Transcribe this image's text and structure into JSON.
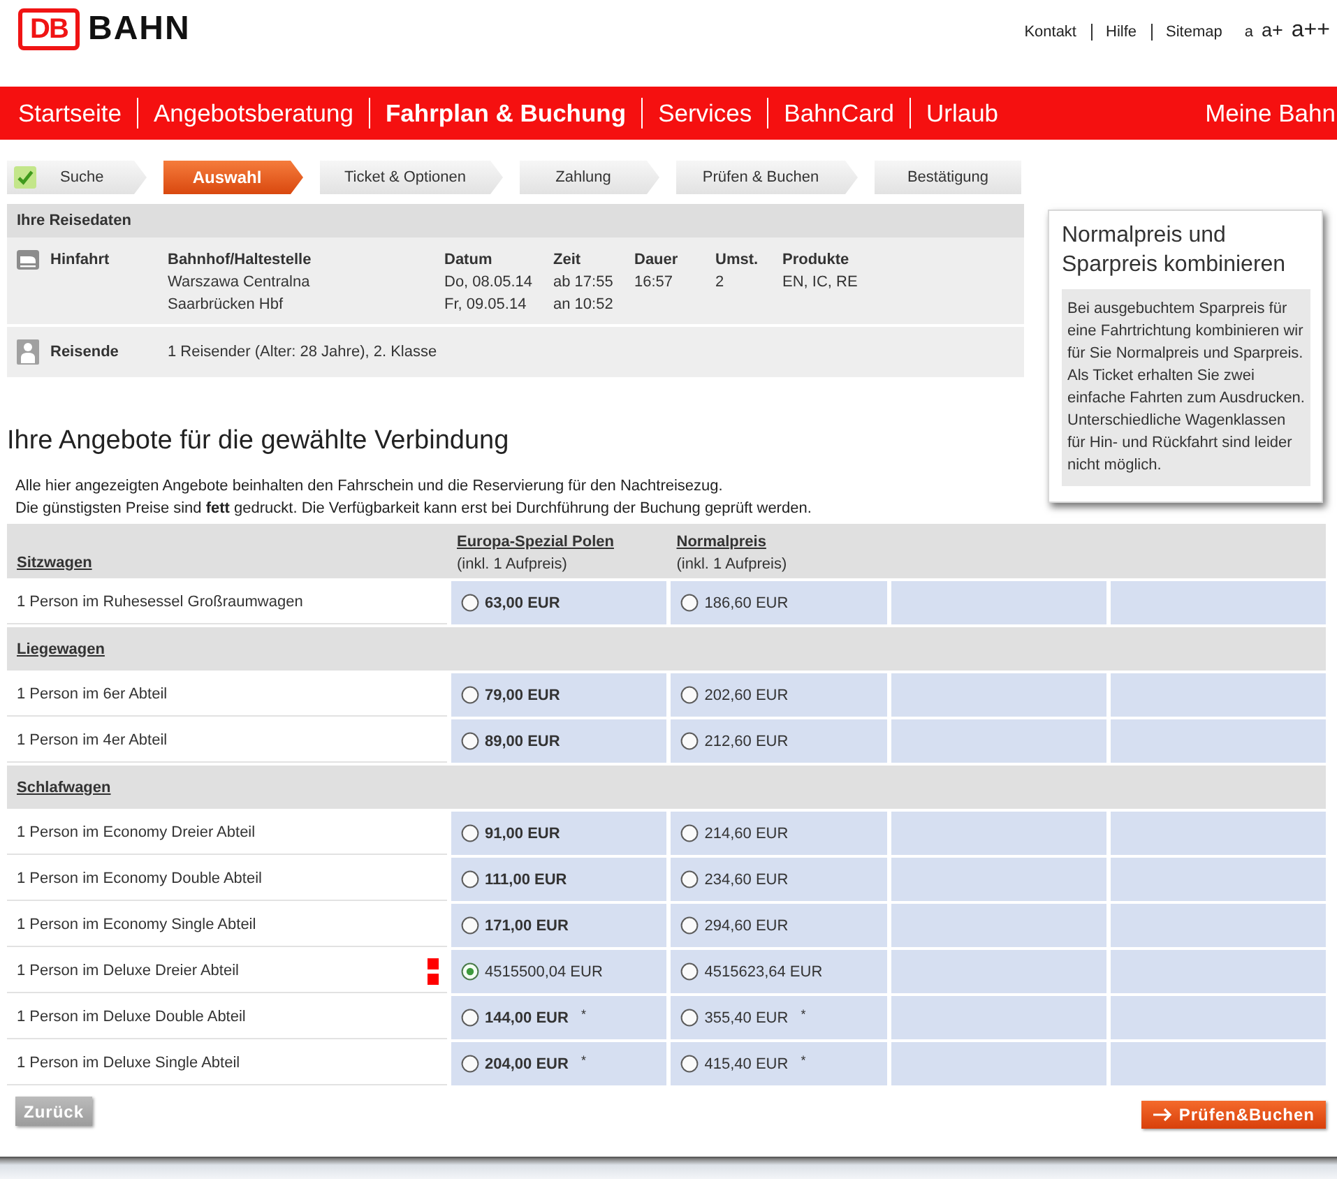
{
  "header": {
    "logo_mark": "DB",
    "logo_text": "BAHN",
    "links": [
      "Kontakt",
      "Hilfe",
      "Sitemap"
    ],
    "text_sizes": [
      "a",
      "a+",
      "a++"
    ]
  },
  "nav": {
    "items": [
      {
        "label": "Startseite",
        "selected": false
      },
      {
        "label": "Angebotsberatung",
        "selected": false
      },
      {
        "label": "Fahrplan & Buchung",
        "selected": true
      },
      {
        "label": "Services",
        "selected": false
      },
      {
        "label": "BahnCard",
        "selected": false
      },
      {
        "label": "Urlaub",
        "selected": false
      }
    ],
    "account": "Meine Bahn"
  },
  "steps": [
    {
      "label": "Suche",
      "selected": false,
      "done": true
    },
    {
      "label": "Auswahl",
      "selected": true,
      "done": false
    },
    {
      "label": "Ticket & Optionen",
      "selected": false,
      "done": false
    },
    {
      "label": "Zahlung",
      "selected": false,
      "done": false
    },
    {
      "label": "Prüfen & Buchen",
      "selected": false,
      "done": false
    },
    {
      "label": "Bestätigung",
      "selected": false,
      "done": false
    }
  ],
  "travel": {
    "title": "Ihre Reisedaten",
    "journey": {
      "label": "Hinfahrt",
      "columns": [
        {
          "heading": "Bahnhof/Haltestelle",
          "lines": [
            "Warszawa Centralna",
            "Saarbrücken Hbf"
          ]
        },
        {
          "heading": "Datum",
          "lines": [
            "Do, 08.05.14",
            "Fr, 09.05.14"
          ]
        },
        {
          "heading": "Zeit",
          "lines": [
            "ab 17:55",
            "an 10:52"
          ]
        },
        {
          "heading": "Dauer",
          "lines": [
            "16:57"
          ]
        },
        {
          "heading": "Umst.",
          "lines": [
            "2"
          ]
        },
        {
          "heading": "Produkte",
          "lines": [
            "EN, IC, RE"
          ]
        }
      ]
    },
    "travellers": {
      "label": "Reisende",
      "text": "1 Reisender (Alter: 28 Jahre), 2. Klasse"
    }
  },
  "info_box": {
    "title": "Normalpreis und Sparpreis kombinieren",
    "text": "Bei ausgebuchtem Sparpreis für eine Fahrtrichtung kombinieren wir für Sie Normalpreis und Sparpreis. Als Ticket erhalten Sie zwei einfache Fahrten zum Ausdrucken. Unterschiedliche Wagenklassen für Hin- und Rückfahrt sind leider nicht möglich."
  },
  "offers": {
    "title": "Ihre Angebote für die gewählte Verbindung",
    "notes": [
      "Alle hier angezeigten Angebote beinhalten den Fahrschein und die Reservierung für den Nachtreisezug.",
      "Die günstigsten Preise sind **fett** gedruckt. Die Verfügbarkeit kann erst bei Durchführung der Buchung geprüft werden."
    ],
    "columns": [
      {
        "name": "Europa-Spezial Polen",
        "note": "(inkl. 1 Aufpreis)"
      },
      {
        "name": "Normalpreis",
        "note": "(inkl. 1 Aufpreis)"
      }
    ],
    "groups": [
      {
        "title": "Sitzwagen",
        "rows": [
          {
            "label": "1 Person im Ruhesessel Großraumwagen",
            "flagged": false,
            "offers": [
              {
                "price": "63,00 EUR",
                "cheapest": true,
                "selected": false
              },
              {
                "price": "186,60 EUR",
                "cheapest": false,
                "selected": false
              }
            ]
          }
        ]
      },
      {
        "title": "Liegewagen",
        "rows": [
          {
            "label": "1 Person im 6er Abteil",
            "flagged": false,
            "offers": [
              {
                "price": "79,00 EUR",
                "cheapest": true,
                "selected": false
              },
              {
                "price": "202,60 EUR",
                "cheapest": false,
                "selected": false
              }
            ]
          },
          {
            "label": "1 Person im 4er Abteil",
            "flagged": false,
            "offers": [
              {
                "price": "89,00 EUR",
                "cheapest": true,
                "selected": false
              },
              {
                "price": "212,60 EUR",
                "cheapest": false,
                "selected": false
              }
            ]
          }
        ]
      },
      {
        "title": "Schlafwagen",
        "rows": [
          {
            "label": "1 Person im Economy Dreier Abteil",
            "flagged": false,
            "offers": [
              {
                "price": "91,00 EUR",
                "cheapest": true,
                "selected": false
              },
              {
                "price": "214,60 EUR",
                "cheapest": false,
                "selected": false
              }
            ]
          },
          {
            "label": "1 Person im Economy Double Abteil",
            "flagged": false,
            "offers": [
              {
                "price": "111,00 EUR",
                "cheapest": true,
                "selected": false
              },
              {
                "price": "234,60 EUR",
                "cheapest": false,
                "selected": false
              }
            ]
          },
          {
            "label": "1 Person im Economy Single Abteil",
            "flagged": false,
            "offers": [
              {
                "price": "171,00 EUR",
                "cheapest": true,
                "selected": false
              },
              {
                "price": "294,60 EUR",
                "cheapest": false,
                "selected": false
              }
            ]
          },
          {
            "label": "1 Person im Deluxe Dreier Abteil",
            "flagged": true,
            "offers": [
              {
                "price": "4515500,04 EUR",
                "cheapest": false,
                "selected": true
              },
              {
                "price": "4515623,64 EUR",
                "cheapest": false,
                "selected": false
              }
            ]
          },
          {
            "label": "1 Person im Deluxe Double Abteil",
            "flagged": false,
            "offers": [
              {
                "price": "144,00 EUR",
                "cheapest": true,
                "selected": false,
                "note": "*"
              },
              {
                "price": "355,40 EUR",
                "cheapest": false,
                "selected": false,
                "note": "*"
              }
            ]
          },
          {
            "label": "1 Person im Deluxe Single Abteil",
            "flagged": false,
            "offers": [
              {
                "price": "204,00 EUR",
                "cheapest": true,
                "selected": false,
                "note": "*"
              },
              {
                "price": "415,40 EUR",
                "cheapest": false,
                "selected": false,
                "note": "*"
              }
            ]
          }
        ]
      }
    ]
  },
  "buttons": {
    "back": "Zurück",
    "next": "Prüfen&Buchen"
  }
}
